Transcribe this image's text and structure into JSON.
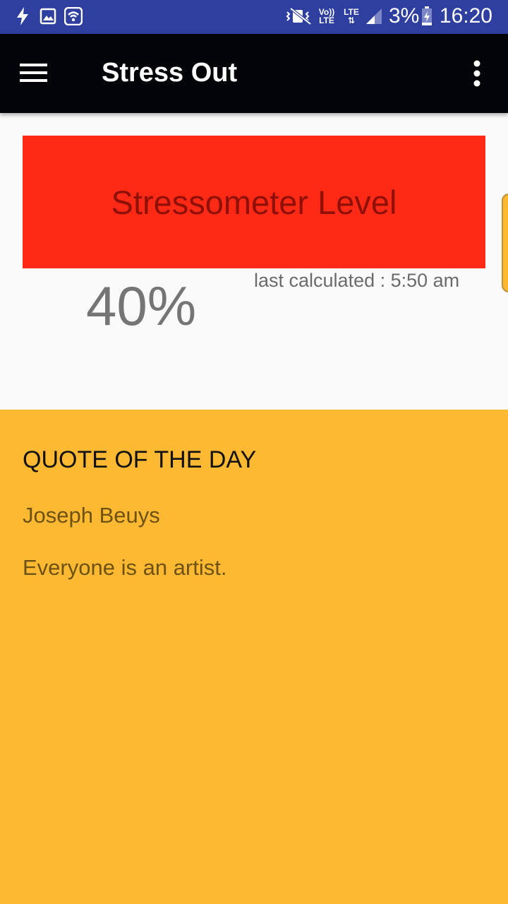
{
  "status_bar": {
    "network_top": "Vo))",
    "network_bottom": "LTE",
    "lte_label": "LTE",
    "battery": "3%",
    "time": "16:20",
    "icons": [
      "flash-icon",
      "image-icon",
      "wifi-hotspot-icon",
      "vibrate-icon",
      "signal-icon",
      "battery-charging-icon"
    ]
  },
  "app_bar": {
    "title": "Stress Out",
    "menu_icon": "hamburger-menu-icon",
    "overflow_icon": "more-vert-icon",
    "background": "#020407"
  },
  "stress": {
    "card_label": "Stressometer Level",
    "card_color": "#fe2a15",
    "value": "40%",
    "last_calculated": "last calculated : 5:50 am"
  },
  "quote": {
    "heading": "QUOTE OF THE DAY",
    "author": "Joseph Beuys",
    "text": "Everyone is an artist.",
    "background": "#feb933"
  }
}
